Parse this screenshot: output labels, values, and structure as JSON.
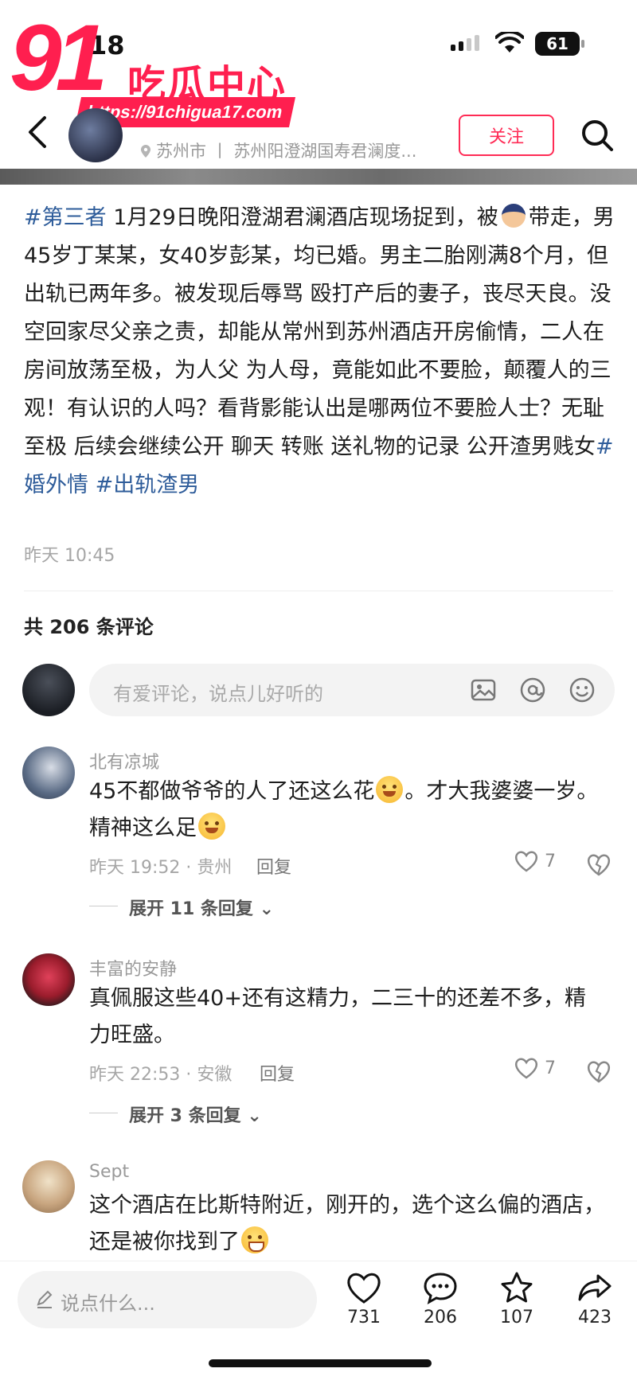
{
  "status_bar": {
    "time": "18",
    "battery": "61"
  },
  "watermark": {
    "number": "91",
    "title": "吃瓜中心",
    "url": "https://91chigua17.com"
  },
  "header": {
    "location": "苏州市 丨 苏州阳澄湖国寿君澜度...",
    "follow_label": "关注"
  },
  "post": {
    "hashtag_1": "#第三者",
    "text_1": " 1月29日晚阳澄湖君澜酒店现场捉到，被",
    "text_2": "带走，男45岁丁某某，女40岁彭某，均已婚。男主二胎刚满8个月，但出轨已两年多。被发现后辱骂 殴打产后的妻子，丧尽天良。没空回家尽父亲之责，却能从常州到苏州酒店开房偷情，二人在房间放荡至极，为人父 为人母，竟能如此不要脸，颠覆人的三观！有认识的人吗？看背影能认出是哪两位不要脸人士？无耻至极 后续会继续公开 聊天 转账 送礼物的记录 公开渣男贱女",
    "hashtag_2": "#婚外情",
    "hashtag_3": " #出轨渣男",
    "time": "昨天 10:45"
  },
  "comments_header": {
    "count_label": "共 206 条评论"
  },
  "compose": {
    "placeholder": "有爱评论，说点儿好听的"
  },
  "comments": [
    {
      "name": "北有凉城",
      "text_a": "45不都做爷爷的人了还这么花",
      "text_b": "。才大我婆婆一岁。精神这么足",
      "meta": "昨天 19:52 · 贵州",
      "reply": "回复",
      "likes": "7",
      "expand": "展开 11 条回复"
    },
    {
      "name": "丰富的安静",
      "text": "真佩服这些40+还有这精力，二三十的还差不多，精力旺盛。",
      "meta": "昨天 22:53 · 安徽",
      "reply": "回复",
      "likes": "7",
      "expand": "展开 3 条回复"
    },
    {
      "name": "Sept",
      "text": "这个酒店在比斯特附近，刚开的，选个这么偏的酒店，还是被你找到了"
    }
  ],
  "bottom_bar": {
    "placeholder": "说点什么...",
    "like_count": "731",
    "comment_count": "206",
    "favorite_count": "107",
    "share_count": "423"
  },
  "colors": {
    "accent": "#ff2b55",
    "hashtag": "#2e5c9a",
    "watermark": "#ff1f4f"
  },
  "icons": [
    "back-icon",
    "search-icon",
    "location-pin-icon",
    "image-icon",
    "at-icon",
    "emoji-icon",
    "heart-icon",
    "dislike-icon",
    "comment-icon",
    "star-icon",
    "share-icon",
    "pen-icon"
  ]
}
